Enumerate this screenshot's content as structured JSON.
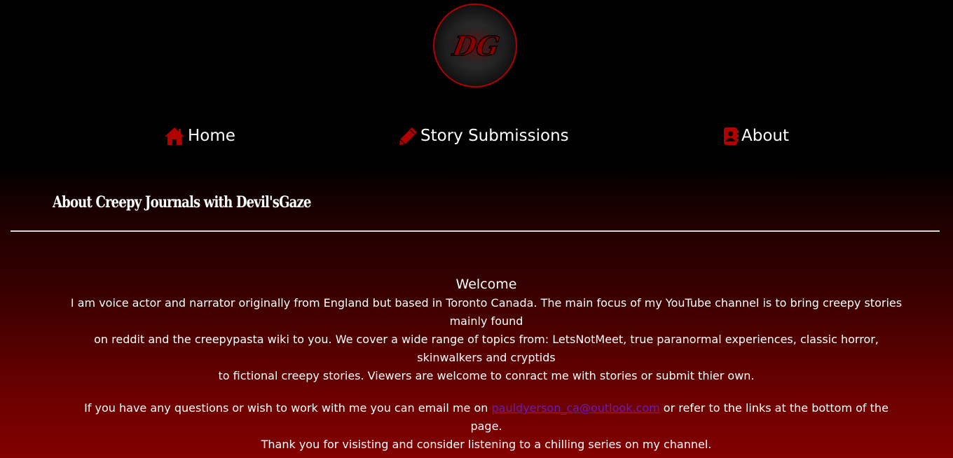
{
  "logo": {
    "text": "DG"
  },
  "nav": {
    "home": "Home",
    "story": "Story Submissions",
    "about": "About"
  },
  "page_title": "About Creepy Journals with Devil'sGaze",
  "content": {
    "welcome": "Welcome",
    "intro_line1": "I am voice actor and narrator originally from England but based in Toronto Canada. The main focus of my YouTube channel is to bring creepy stories mainly found",
    "intro_line2": "on reddit and the creepypasta wiki to you. We cover a wide range of topics from: LetsNotMeet, true paranormal experiences, classic horror, skinwalkers and cryptids",
    "intro_line3": "to fictional creepy stories. Viewers are welcome to conract me with stories or submit thier own.",
    "contact_before": "If you have any questions or wish to work with me you can email me on ",
    "email": "pauldyerson_ca@outlook.com",
    "contact_after": " or refer to the links at the bottom of the page.",
    "thanks": "Thank you for visisting and consider listening to a chilling series on my channel."
  },
  "colors": {
    "accent": "#b00000",
    "link": "#6a1bbb",
    "background_top": "#000000",
    "background_bottom": "#830000"
  },
  "icons": {
    "home": "home-icon",
    "story": "pencil-icon",
    "about": "address-book-icon"
  }
}
